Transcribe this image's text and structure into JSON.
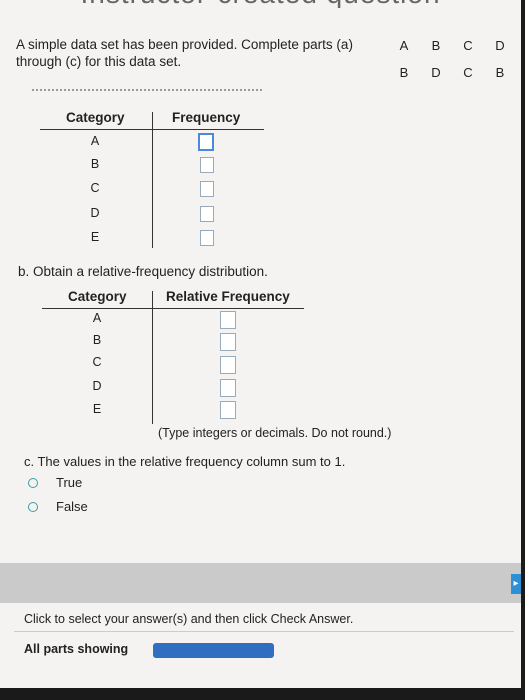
{
  "header": {
    "title": "Instructor-created question"
  },
  "prompt": "A simple data set has been provided. Complete parts (a) through (c) for this data set.",
  "dataset": {
    "rows": [
      [
        "A",
        "B",
        "C",
        "D"
      ],
      [
        "B",
        "D",
        "C",
        "B"
      ]
    ]
  },
  "part_a": {
    "category_header": "Category",
    "frequency_header": "Frequency",
    "categories": [
      "A",
      "B",
      "C",
      "D",
      "E"
    ]
  },
  "part_b": {
    "label": "b. Obtain a relative-frequency distribution.",
    "category_header": "Category",
    "value_header": "Relative Frequency",
    "categories": [
      "A",
      "B",
      "C",
      "D",
      "E"
    ],
    "hint": "(Type integers or decimals. Do not round.)"
  },
  "part_c": {
    "label": "c. The values in the relative frequency column sum to 1.",
    "options": [
      "True",
      "False"
    ]
  },
  "footer": {
    "click_text": "Click to select your answer(s) and then click Check Answer.",
    "all_parts": "All parts showing"
  }
}
